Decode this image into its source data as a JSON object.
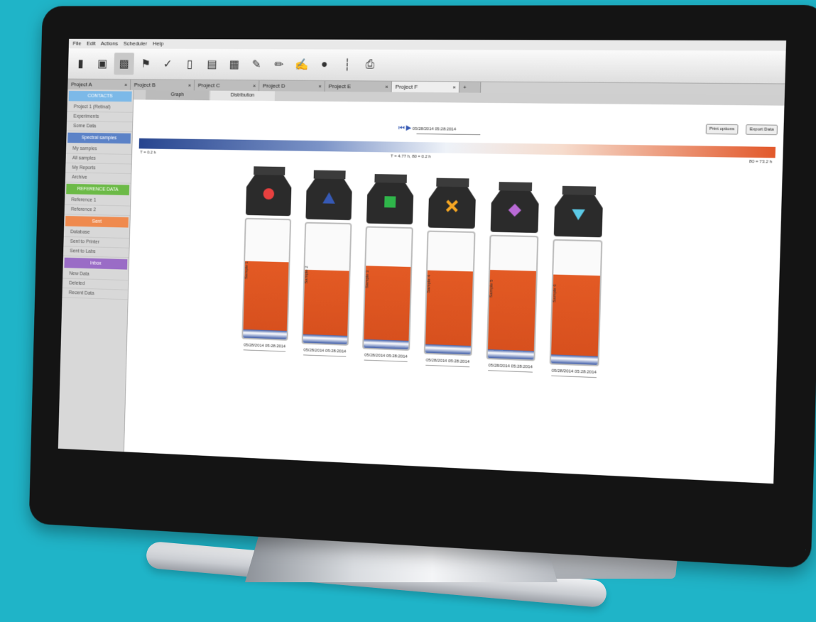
{
  "menu": [
    "File",
    "Edit",
    "Actions",
    "Scheduler",
    "Help"
  ],
  "toolbar_icons": [
    "file-icon",
    "folder-icon",
    "calendar-icon",
    "bookmark-icon",
    "tag-icon",
    "document-icon",
    "folder-open-icon",
    "grid-icon",
    "edit-icon",
    "edit-alt-icon",
    "edit-underline-icon",
    "settings-icon",
    "thermometer-icon",
    "print-icon"
  ],
  "project_tabs": [
    "Project A",
    "Project B",
    "Project C",
    "Project D",
    "Project E",
    "Project F"
  ],
  "sidebar": {
    "sections": [
      {
        "title": "CONTACTS",
        "color": "#7cb9e8",
        "items": [
          "Project 1 (Retinal)",
          "Experiments",
          "Some Data"
        ]
      },
      {
        "title": "Spectral samples",
        "color": "#5b82c7",
        "items": [
          "My samples",
          "All samples",
          "My Reports",
          "Archive"
        ]
      },
      {
        "title": "REFERENCE DATA",
        "color": "#6cba47",
        "items": [
          "Reference 1",
          "Reference 2"
        ]
      },
      {
        "title": "Sent",
        "color": "#ef8a4e",
        "items": [
          "Database",
          "Sent to Printer",
          "Sent to Labs"
        ]
      },
      {
        "title": "Inbox",
        "color": "#9a6cc6",
        "items": [
          "New Data",
          "Deleted",
          "Recent Data"
        ]
      }
    ]
  },
  "subtabs": [
    "Graph",
    "Distribution"
  ],
  "buttons": {
    "print": "Print options",
    "export": "Export Data"
  },
  "player": {
    "time": "05/28/2014 05:28:2014"
  },
  "scale": {
    "left": "T = 0.2 h",
    "center": "T = 4.77 h, 80 = 0.2 h",
    "right": "80 = 73.2 h"
  },
  "vials": [
    {
      "label": "Sample 1",
      "shape": "circle",
      "color": "#e8403f",
      "fill": 0.62,
      "time": "05/28/2014 05:28:2014"
    },
    {
      "label": "Sample 2",
      "shape": "triangle",
      "color": "#3659b4",
      "fill": 0.58,
      "time": "05/28/2014 05:28:2014"
    },
    {
      "label": "Sample 3",
      "shape": "square",
      "color": "#2fb54a",
      "fill": 0.66,
      "time": "05/28/2014 05:28:2014"
    },
    {
      "label": "Sample 4",
      "shape": "cross",
      "color": "#f5a623",
      "fill": 0.66,
      "time": "05/28/2014 05:28:2014"
    },
    {
      "label": "Sample 5",
      "shape": "diamond",
      "color": "#b96ad6",
      "fill": 0.7,
      "time": "05/28/2014 05:28:2014"
    },
    {
      "label": "Sample 6",
      "shape": "inv-triangle",
      "color": "#5bc9e6",
      "fill": 0.7,
      "time": "05/28/2014 05:28:2014"
    }
  ]
}
